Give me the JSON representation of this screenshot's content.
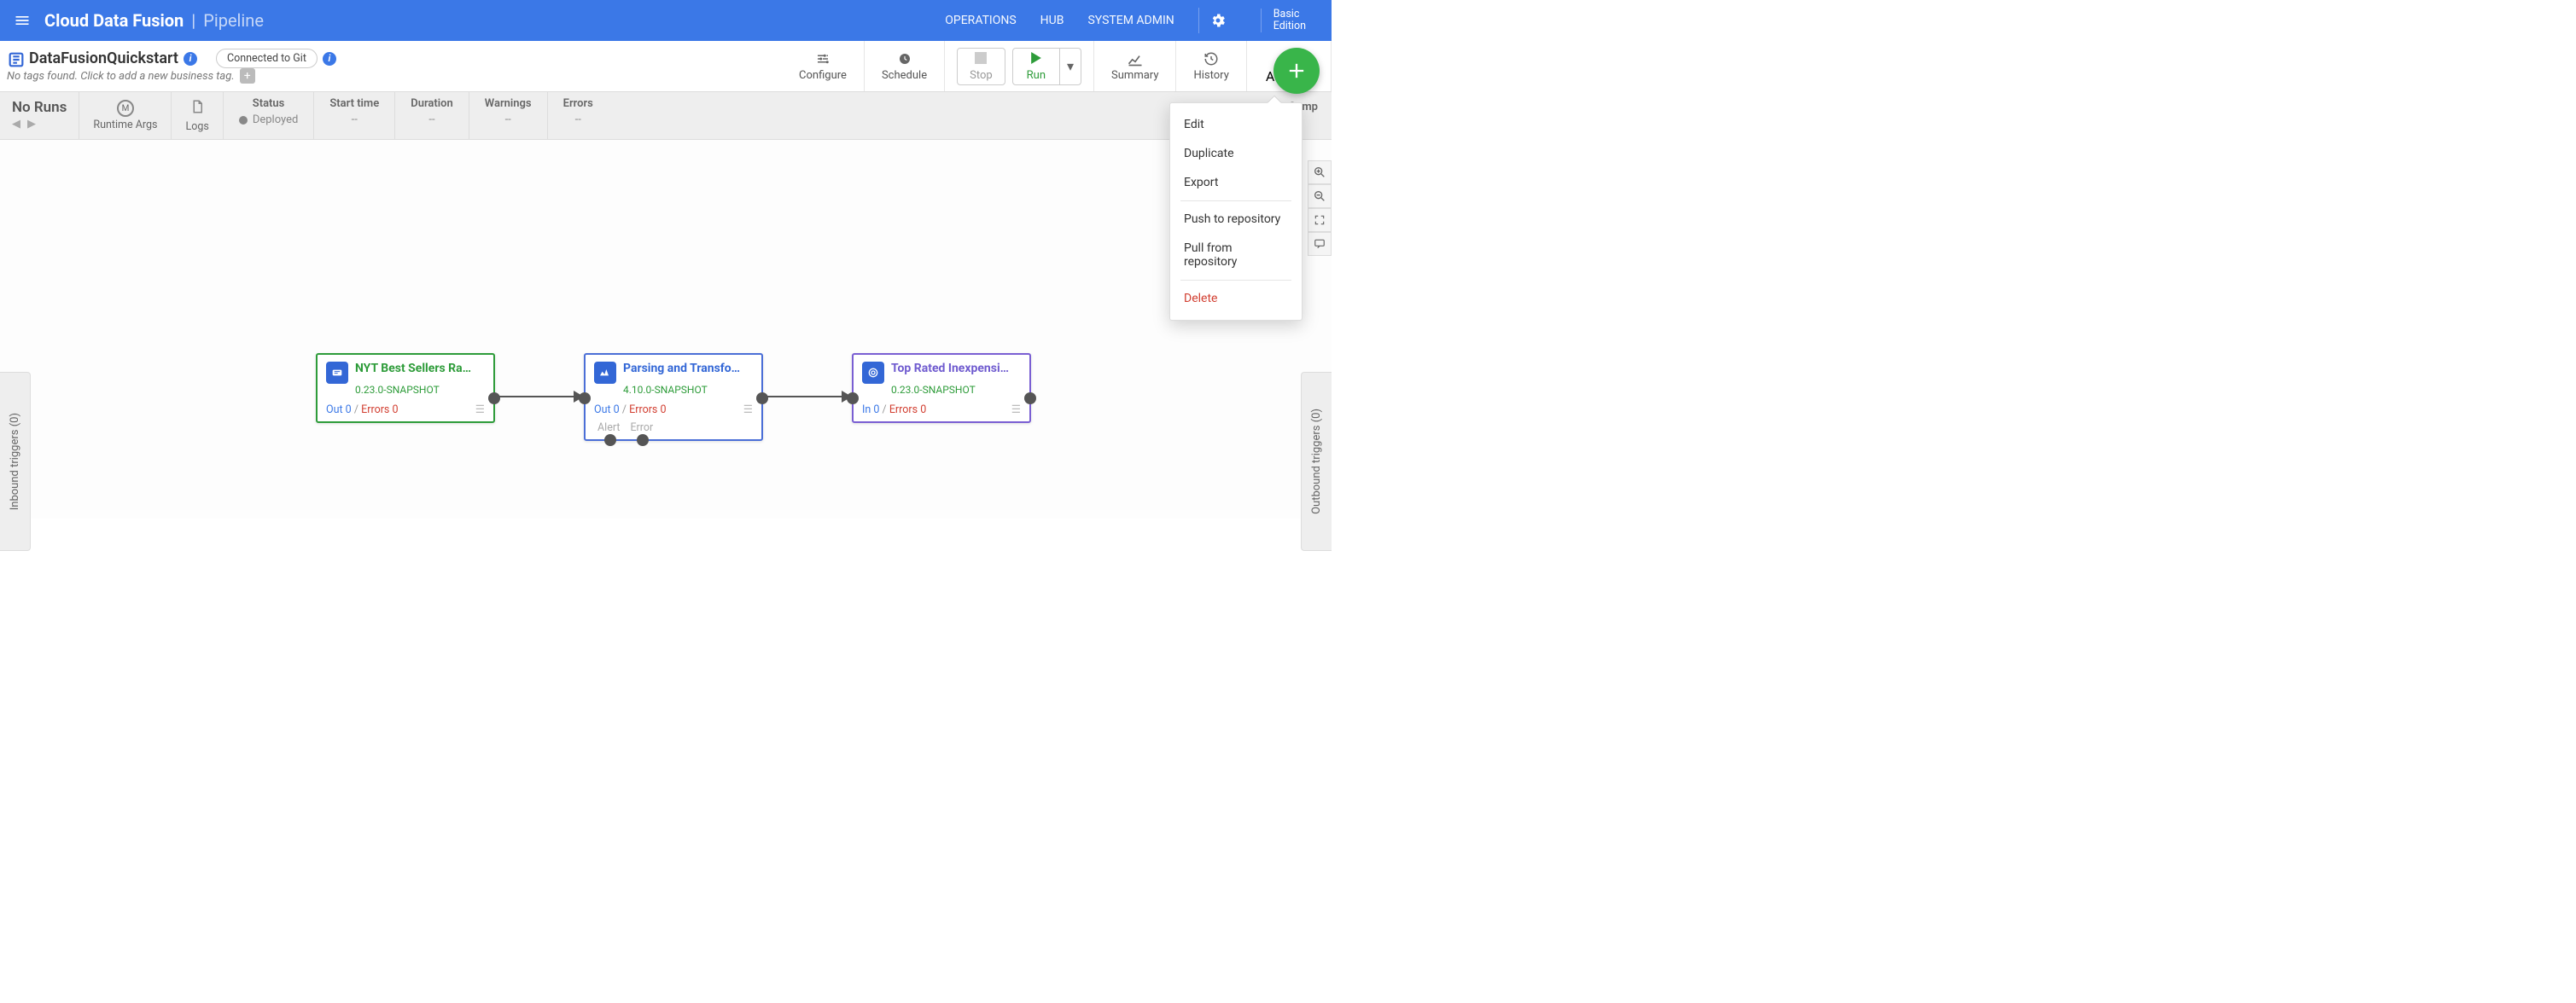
{
  "header": {
    "brand_main": "Cloud Data Fusion",
    "brand_sub": "Pipeline",
    "links": {
      "operations": "OPERATIONS",
      "hub": "HUB",
      "sysadmin": "SYSTEM ADMIN"
    },
    "edition_l1": "Basic",
    "edition_l2": "Edition"
  },
  "pipeline": {
    "name": "DataFusionQuickstart",
    "tags_hint": "No tags found. Click to add a new business tag.",
    "git_label": "Connected to Git",
    "buttons": {
      "configure": "Configure",
      "schedule": "Schedule",
      "stop": "Stop",
      "run": "Run",
      "summary": "Summary",
      "history": "History",
      "actions": "Actions"
    }
  },
  "status": {
    "noruns": "No Runs",
    "runtime_args": "Runtime Args",
    "logs": "Logs",
    "status_t": "Status",
    "status_v": "Deployed",
    "start_t": "Start time",
    "start_v": "--",
    "dur_t": "Duration",
    "dur_v": "--",
    "warn_t": "Warnings",
    "warn_v": "--",
    "err_t": "Errors",
    "err_v": "--",
    "compute": "Comp"
  },
  "side": {
    "inbound": "Inbound triggers (0)",
    "outbound": "Outbound triggers (0)"
  },
  "dropdown": {
    "edit": "Edit",
    "duplicate": "Duplicate",
    "export": "Export",
    "push": "Push to repository",
    "pull": "Pull from repository",
    "delete": "Delete"
  },
  "nodes": {
    "n1": {
      "title": "NYT Best Sellers Ra…",
      "version": "0.23.0-SNAPSHOT",
      "out": "Out 0",
      "err": "Errors 0",
      "color": "#2e9c3a",
      "titlecolor": "#2e9c3a",
      "iconbg": "#3367d6"
    },
    "n2": {
      "title": "Parsing and Transfo…",
      "version": "4.10.0-SNAPSHOT",
      "out": "Out 0",
      "err": "Errors 0",
      "alert": "Alert",
      "errorlbl": "Error",
      "color": "#4b6fd7",
      "titlecolor": "#3367d6",
      "iconbg": "#3367d6"
    },
    "n3": {
      "title": "Top Rated Inexpensi…",
      "version": "0.23.0-SNAPSHOT",
      "in": "In 0",
      "err": "Errors 0",
      "color": "#7a5fd3",
      "titlecolor": "#6f5bcf",
      "iconbg": "#3367d6"
    }
  }
}
